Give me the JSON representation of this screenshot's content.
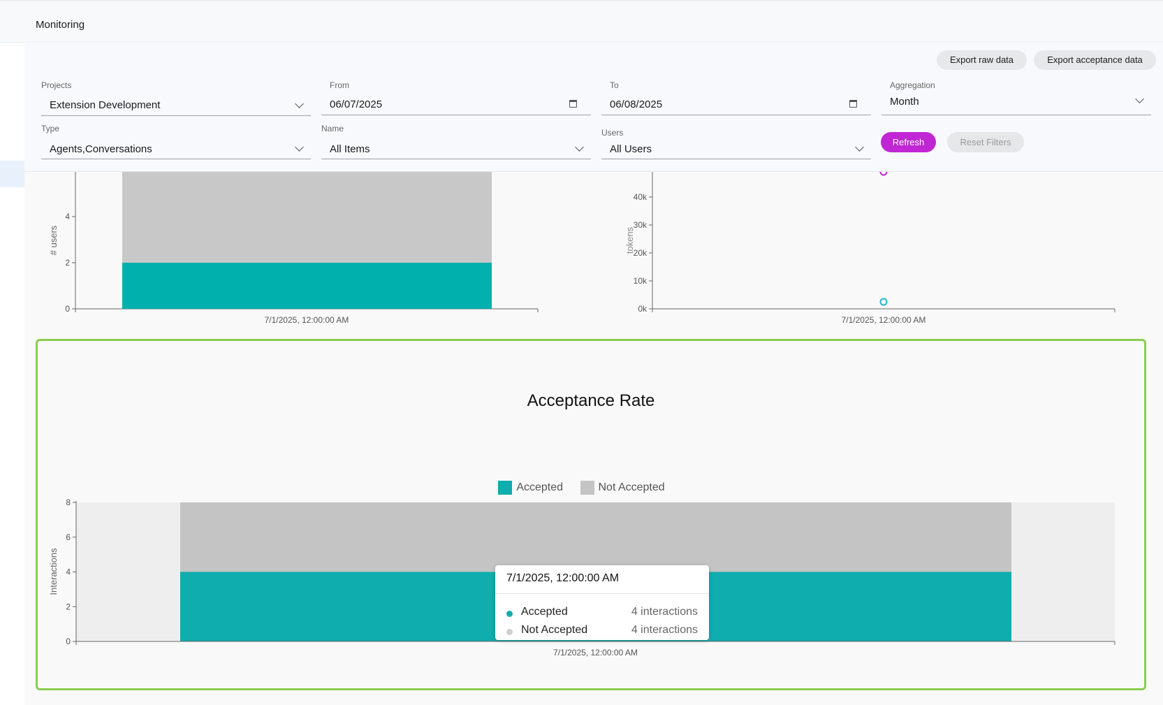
{
  "header": {
    "title": "Monitoring"
  },
  "actions": {
    "export_raw": "Export raw data",
    "export_acceptance": "Export acceptance data"
  },
  "filters": {
    "projects": {
      "label": "Projects",
      "value": "Extension Development"
    },
    "from": {
      "label": "From",
      "value": "06/07/2025"
    },
    "to": {
      "label": "To",
      "value": "06/08/2025"
    },
    "aggregation": {
      "label": "Aggregation",
      "value": "Month"
    },
    "type": {
      "label": "Type",
      "value": "Agents,Conversations"
    },
    "name": {
      "label": "Name",
      "value": "All Items"
    },
    "users": {
      "label": "Users",
      "value": "All Users"
    },
    "refresh_label": "Refresh",
    "reset_label": "Reset Filters"
  },
  "colors": {
    "accepted": "#0fadad",
    "not_accepted": "#c4c4c4",
    "accent": "#c026d3",
    "highlight": "#8ccd4f"
  },
  "chart_data": [
    {
      "type": "bar",
      "title": "",
      "ylabel": "# users",
      "categories": [
        "7/1/2025, 12:00:00 AM"
      ],
      "y_ticks": [
        0,
        2,
        4
      ],
      "series": [
        {
          "values": [
            2
          ],
          "color": "#00b0ad"
        },
        {
          "values": [
            4
          ],
          "color": "#c8c8c8"
        }
      ],
      "ylim": [
        0,
        6
      ]
    },
    {
      "type": "scatter",
      "title": "",
      "ylabel": "tokens",
      "x": [
        "7/1/2025, 12:00:00 AM"
      ],
      "y_ticks": [
        "0k",
        "10k",
        "20k",
        "30k",
        "40k"
      ],
      "series": [
        {
          "values": [
            49000
          ],
          "color": "#c026d3"
        },
        {
          "values": [
            2500
          ],
          "color": "#22b5cc"
        }
      ],
      "ylim": [
        0,
        50000
      ]
    },
    {
      "type": "bar",
      "title": "Acceptance Rate",
      "ylabel": "Interactions",
      "categories": [
        "7/1/2025, 12:00:00 AM"
      ],
      "y_ticks": [
        0,
        2,
        4,
        6,
        8
      ],
      "series": [
        {
          "name": "Accepted",
          "values": [
            4
          ],
          "color": "#0fadad"
        },
        {
          "name": "Not Accepted",
          "values": [
            4
          ],
          "color": "#c4c4c4"
        }
      ],
      "ylim": [
        0,
        8
      ],
      "legend": "top-center"
    }
  ],
  "tooltip": {
    "title": "7/1/2025, 12:00:00 AM",
    "rows": [
      {
        "name": "Accepted",
        "value": "4 interactions"
      },
      {
        "name": "Not Accepted",
        "value": "4 interactions"
      }
    ]
  }
}
